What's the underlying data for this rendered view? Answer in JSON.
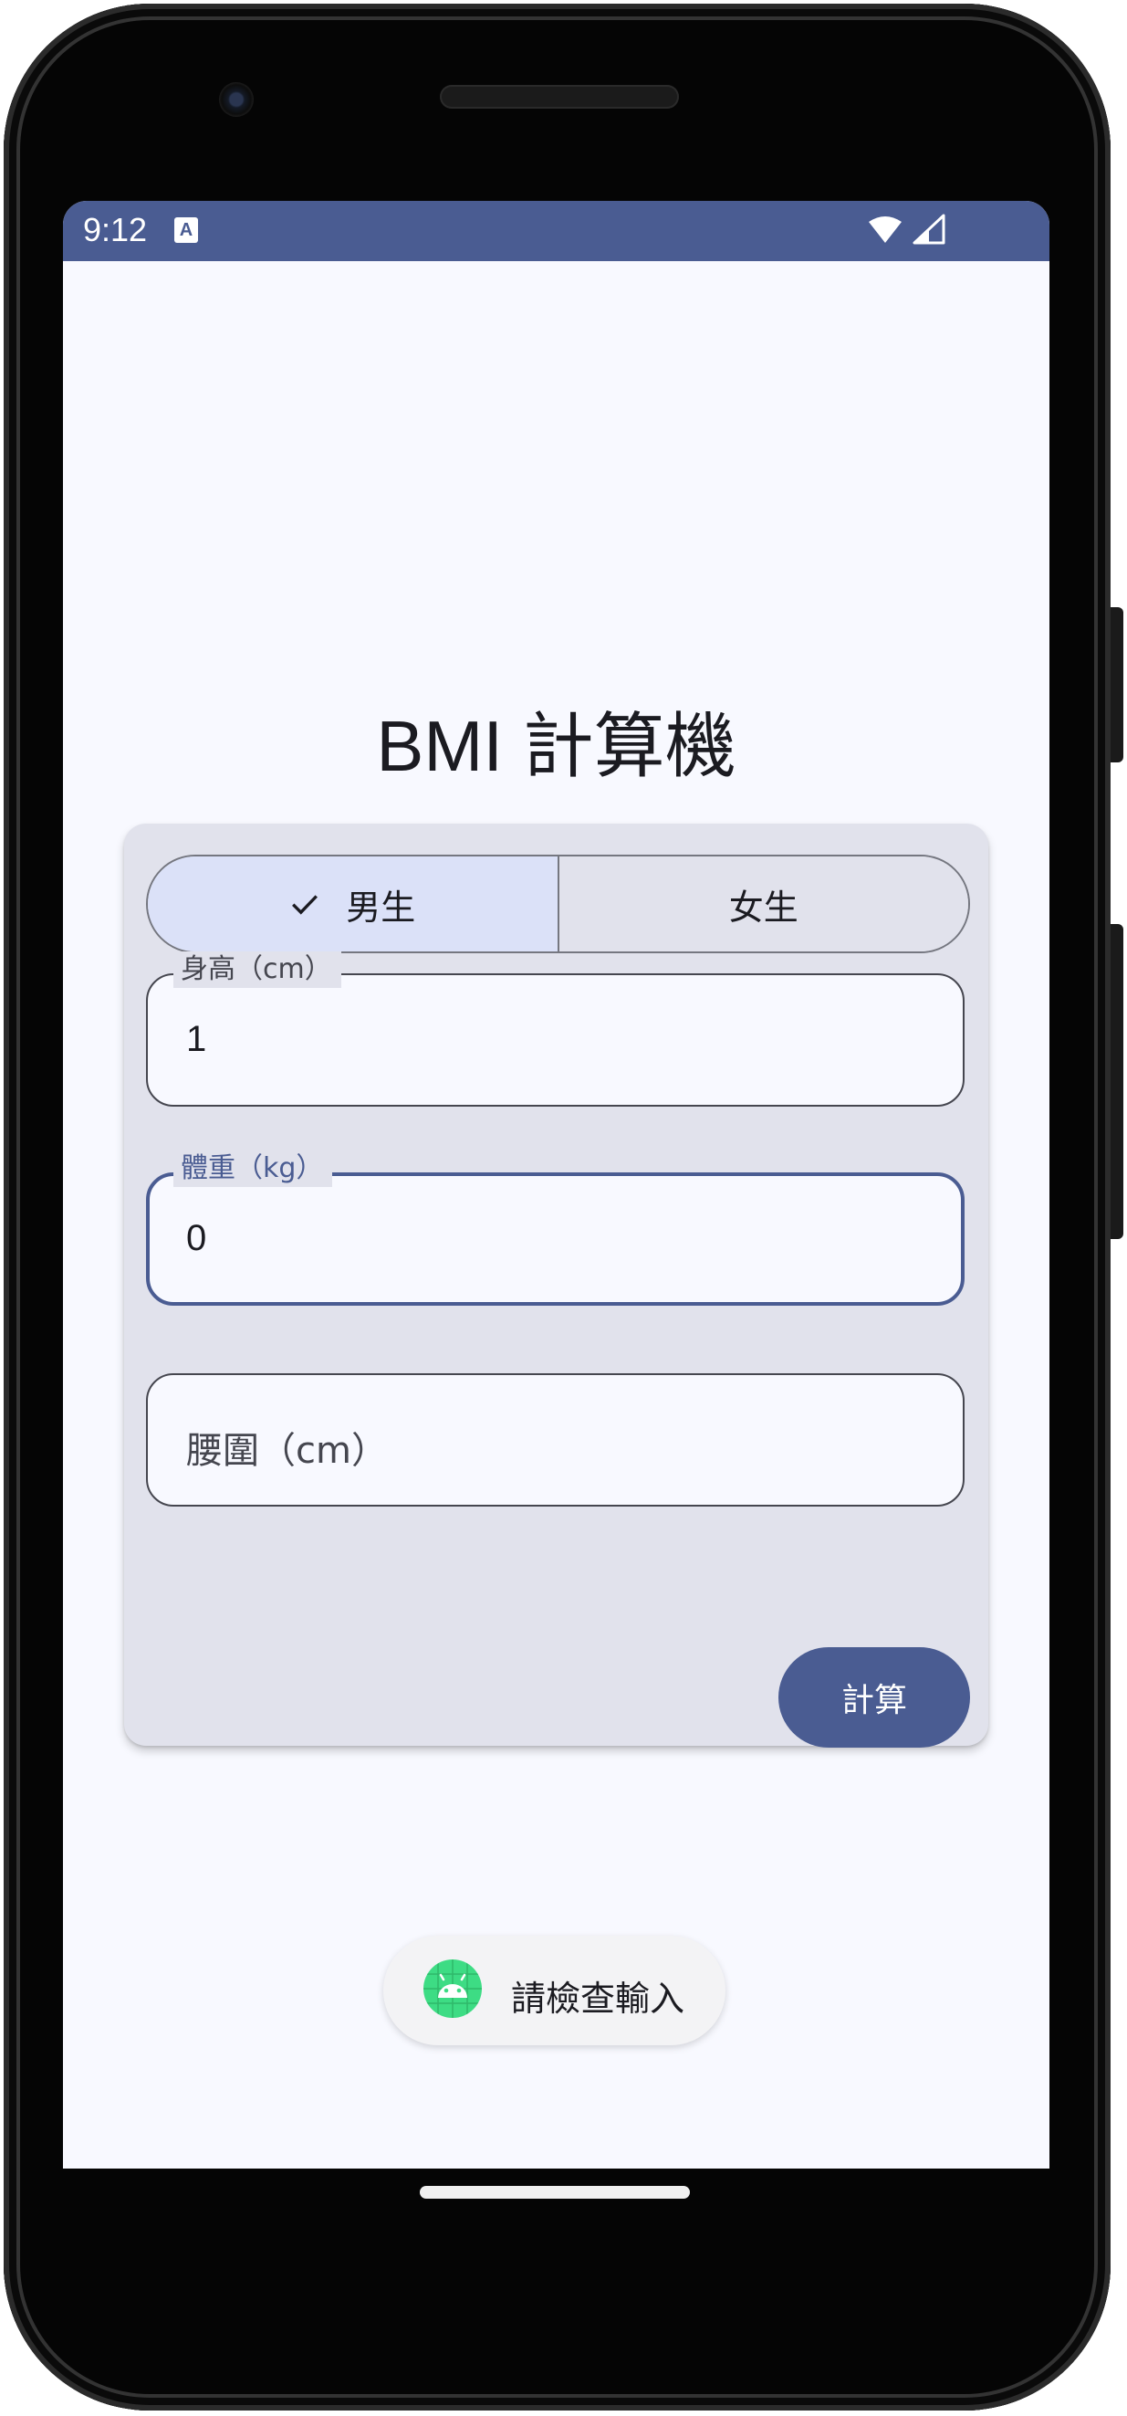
{
  "status_bar": {
    "time": "9:12",
    "notification_icon": "A",
    "icons": [
      "wifi-icon",
      "cellular-signal-icon"
    ],
    "color": "#4a5c92"
  },
  "app": {
    "title": "BMI 計算機"
  },
  "gender": {
    "options": [
      {
        "label": "男生",
        "selected": true
      },
      {
        "label": "女生",
        "selected": false
      }
    ]
  },
  "fields": {
    "height": {
      "label": "身高（cm）",
      "value": "1"
    },
    "weight": {
      "label": "體重（kg）",
      "value": "0",
      "focused": true
    },
    "waist": {
      "placeholder": "腰圍（cm）",
      "value": ""
    }
  },
  "actions": {
    "calculate_label": "計算"
  },
  "toast": {
    "message": "請檢查輸入",
    "icon": "android-icon"
  },
  "colors": {
    "primary": "#4a5c92",
    "background": "#f8f9ff",
    "card": "#e1e2ec",
    "selected_segment": "#dbe1f8"
  }
}
